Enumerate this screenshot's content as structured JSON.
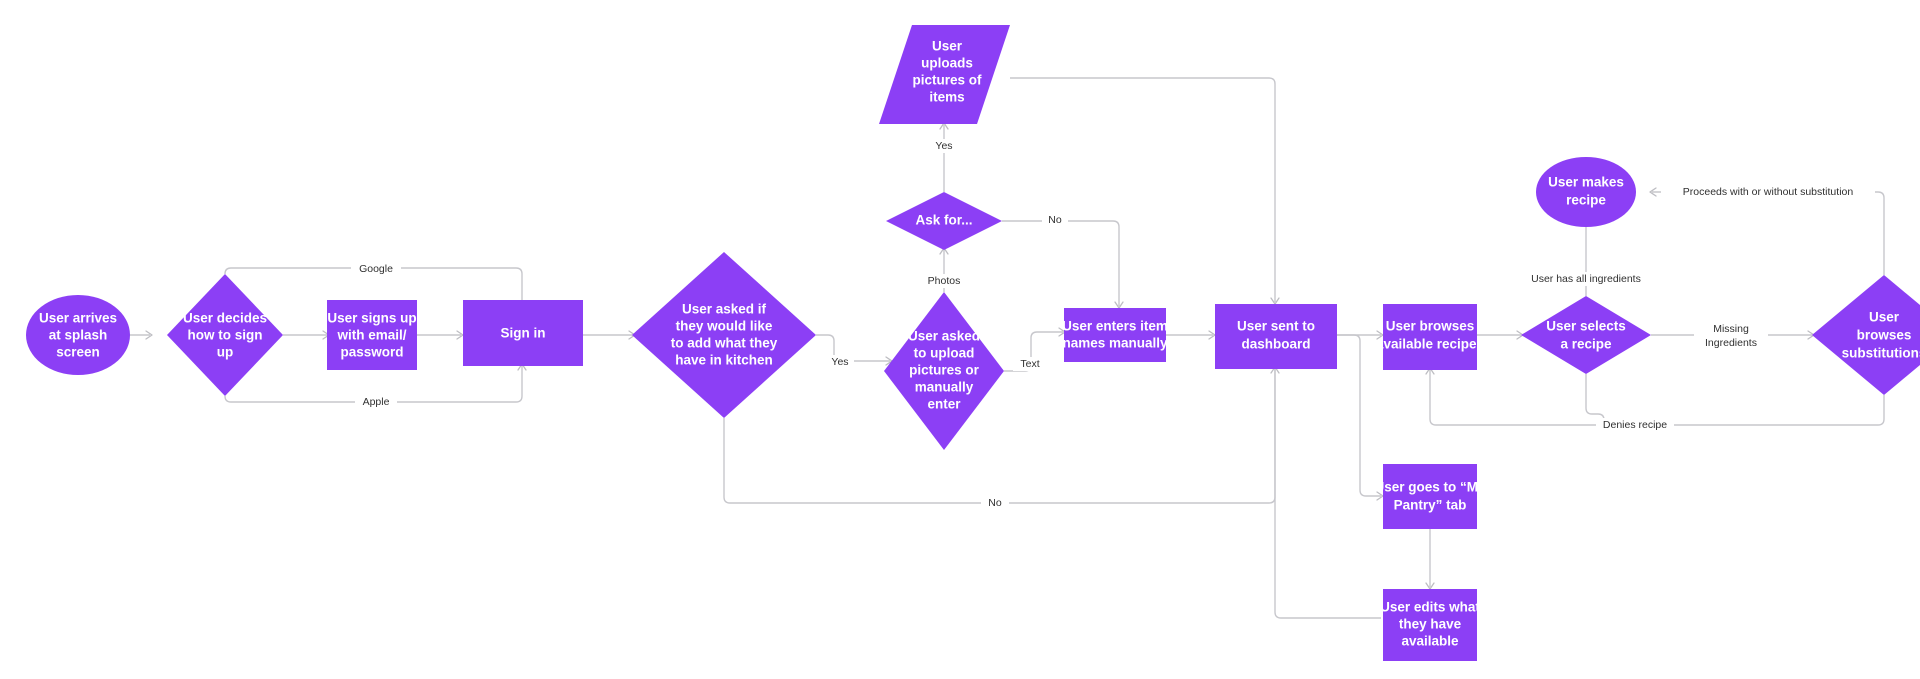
{
  "diagram": {
    "title": "User flow diagram",
    "background_color": "#ffffff",
    "node_fill_color": "#8C3FF5",
    "node_text_color": "#ffffff",
    "edge_color": "#c7c7cc",
    "edge_label_color": "#303030"
  },
  "nodes": [
    {
      "id": "n1",
      "shape": "ellipse",
      "lines": [
        "User arrives",
        "at splash",
        "screen"
      ]
    },
    {
      "id": "n2",
      "shape": "diamond",
      "lines": [
        "User decides",
        "how to sign",
        "up"
      ]
    },
    {
      "id": "n3",
      "shape": "rect",
      "lines": [
        "User signs up",
        "with email/",
        "password"
      ]
    },
    {
      "id": "n4",
      "shape": "rect",
      "lines": [
        "Sign in"
      ]
    },
    {
      "id": "n5",
      "shape": "diamond",
      "lines": [
        "User asked if",
        "they would like",
        "to add what they",
        "have in kitchen"
      ]
    },
    {
      "id": "n6",
      "shape": "diamond",
      "lines": [
        "User asked",
        "to upload",
        "pictures or",
        "manually",
        "enter"
      ]
    },
    {
      "id": "n7",
      "shape": "diamond",
      "lines": [
        "Ask for..."
      ]
    },
    {
      "id": "n8",
      "shape": "parallelogram",
      "lines": [
        "User",
        "uploads",
        "pictures of",
        "items"
      ]
    },
    {
      "id": "n9",
      "shape": "rect",
      "lines": [
        "User enters item",
        "names manually"
      ]
    },
    {
      "id": "n10",
      "shape": "rect",
      "lines": [
        "User sent to",
        "dashboard"
      ]
    },
    {
      "id": "n11",
      "shape": "rect",
      "lines": [
        "User browses",
        "available recipes"
      ]
    },
    {
      "id": "n12",
      "shape": "diamond",
      "lines": [
        "User selects",
        "a recipe"
      ]
    },
    {
      "id": "n13",
      "shape": "ellipse",
      "lines": [
        "User makes",
        "recipe"
      ]
    },
    {
      "id": "n14",
      "shape": "diamond",
      "lines": [
        "User",
        "browses",
        "substitutions"
      ]
    },
    {
      "id": "n15",
      "shape": "rect",
      "lines": [
        "User goes to “My",
        "Pantry” tab"
      ]
    },
    {
      "id": "n16",
      "shape": "rect",
      "lines": [
        "User edits what",
        "they have",
        "available"
      ]
    }
  ],
  "edge_labels": [
    {
      "id": "e_google",
      "text": "Google"
    },
    {
      "id": "e_apple",
      "text": "Apple"
    },
    {
      "id": "e_yes1",
      "text": "Yes"
    },
    {
      "id": "e_no1",
      "text": "No"
    },
    {
      "id": "e_photos",
      "text": "Photos"
    },
    {
      "id": "e_text",
      "text": "Text"
    },
    {
      "id": "e_yes2",
      "text": "Yes"
    },
    {
      "id": "e_no2",
      "text": "No"
    },
    {
      "id": "e_hasall",
      "text": "User has all ingredients"
    },
    {
      "id": "e_missing1",
      "text": "Missing"
    },
    {
      "id": "e_missing2",
      "text": "Ingredients"
    },
    {
      "id": "e_proceeds",
      "text": "Proceeds with or without substitution"
    },
    {
      "id": "e_denies",
      "text": "Denies recipe"
    }
  ]
}
